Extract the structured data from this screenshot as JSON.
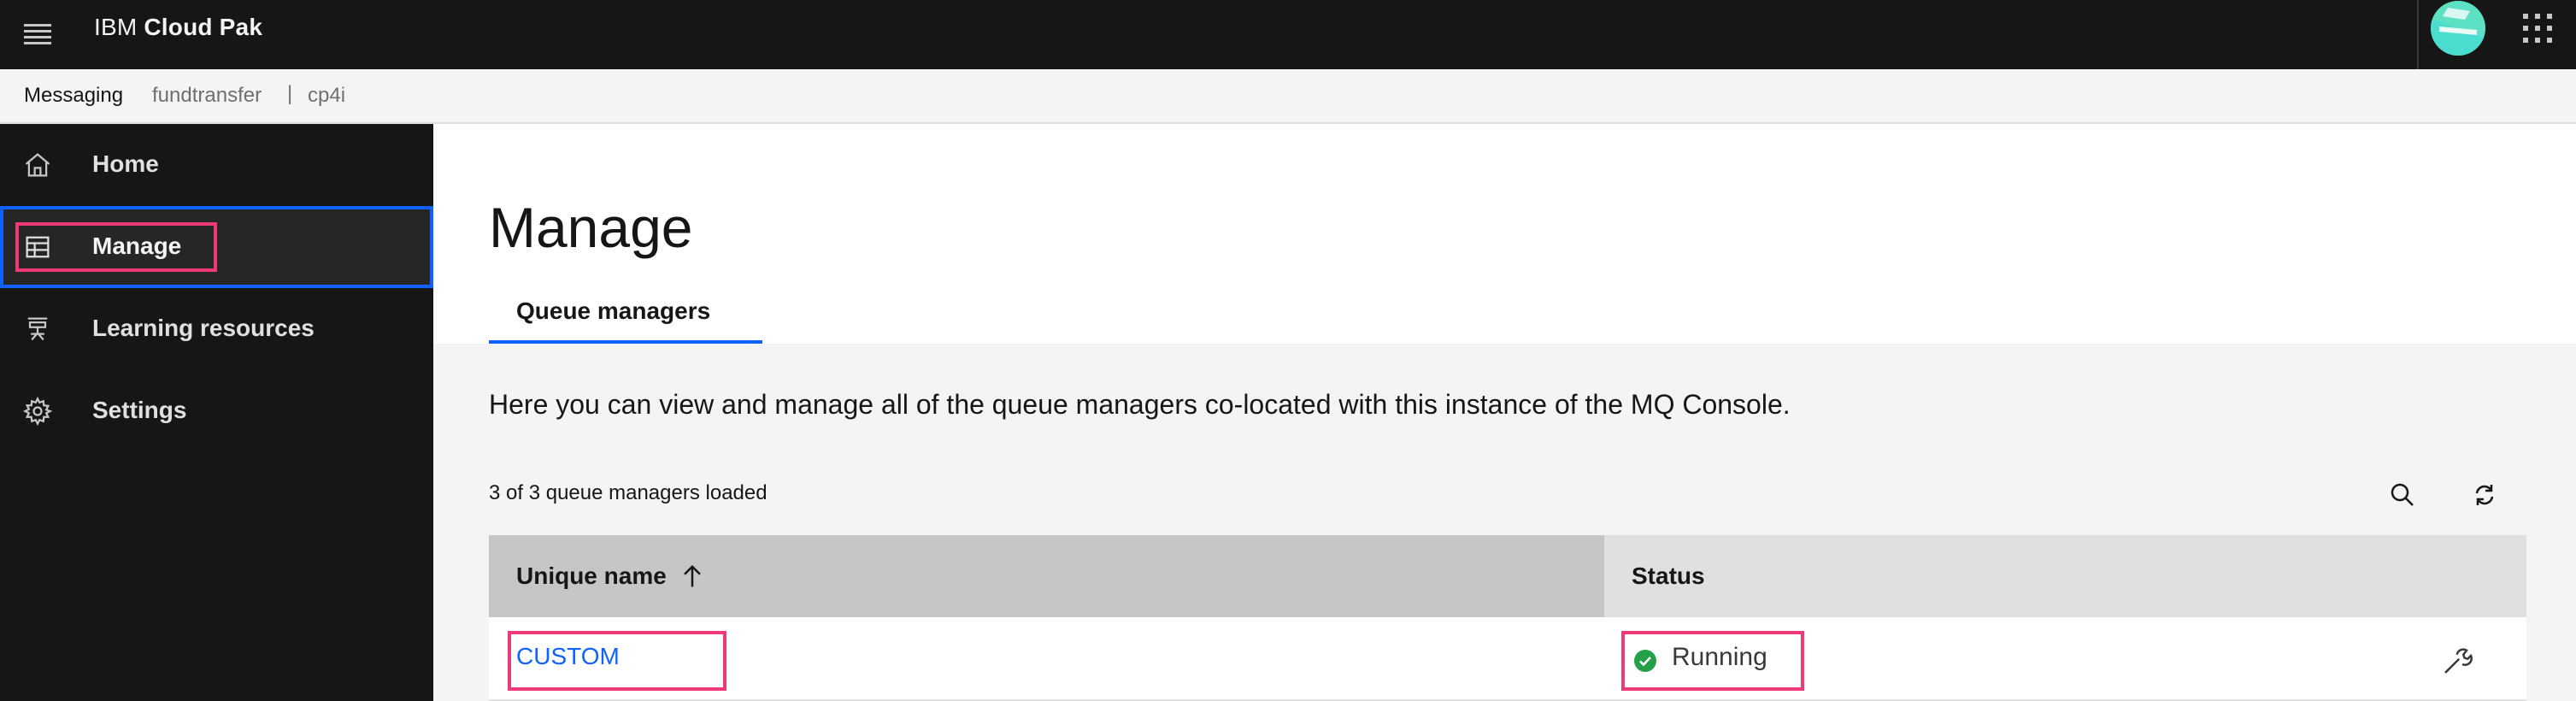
{
  "header": {
    "brand_prefix": "IBM",
    "brand_name": "Cloud Pak"
  },
  "subheader": {
    "product": "Messaging",
    "instance": "fundtransfer",
    "separator": "|",
    "namespace": "cp4i"
  },
  "sidebar": {
    "items": [
      {
        "label": "Home",
        "icon": "home-icon"
      },
      {
        "label": "Manage",
        "icon": "table-icon",
        "active": true
      },
      {
        "label": "Learning resources",
        "icon": "learning-icon"
      },
      {
        "label": "Settings",
        "icon": "gear-icon"
      }
    ]
  },
  "main": {
    "title": "Manage",
    "tabs": [
      {
        "label": "Queue managers",
        "selected": true
      }
    ],
    "description": "Here you can view and manage all of the queue managers co-located with this instance of the MQ Console.",
    "count_text": "3 of 3 queue managers loaded"
  },
  "table": {
    "columns": [
      "Unique name",
      "Status"
    ],
    "rows": [
      {
        "name": "CUSTOM",
        "status": "Running"
      }
    ]
  },
  "colors": {
    "accent": "#0f62fe",
    "highlight": "#ee3a79",
    "status_ok": "#24a148",
    "topbar": "#161616"
  }
}
